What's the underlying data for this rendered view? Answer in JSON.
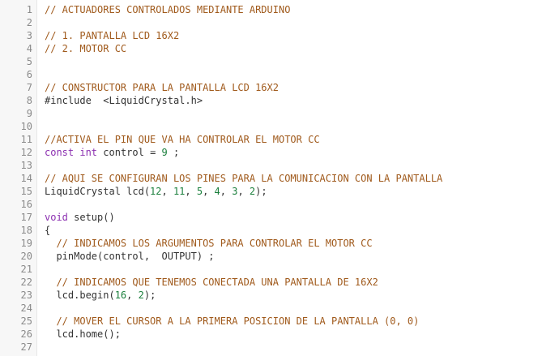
{
  "colors": {
    "comment": "#a05a1c",
    "keyword": "#8b2fb0",
    "number": "#1a7f3c",
    "plain": "#333333",
    "line_number": "#8a8a8a",
    "gutter_background": "#f7f7f7"
  },
  "lines": [
    {
      "number": "1",
      "tokens": [
        {
          "type": "comment",
          "text": "// ACTUADORES CONTROLADOS MEDIANTE ARDUINO"
        }
      ]
    },
    {
      "number": "2",
      "tokens": []
    },
    {
      "number": "3",
      "tokens": [
        {
          "type": "comment",
          "text": "// 1. PANTALLA LCD 16X2"
        }
      ]
    },
    {
      "number": "4",
      "tokens": [
        {
          "type": "comment",
          "text": "// 2. MOTOR CC"
        }
      ]
    },
    {
      "number": "5",
      "tokens": []
    },
    {
      "number": "6",
      "tokens": []
    },
    {
      "number": "7",
      "tokens": [
        {
          "type": "comment",
          "text": "// CONSTRUCTOR PARA LA PANTALLA LCD 16X2"
        }
      ]
    },
    {
      "number": "8",
      "tokens": [
        {
          "type": "plain",
          "text": "#include  <LiquidCrystal.h>"
        }
      ]
    },
    {
      "number": "9",
      "tokens": []
    },
    {
      "number": "10",
      "tokens": []
    },
    {
      "number": "11",
      "tokens": [
        {
          "type": "comment",
          "text": "//ACTIVA EL PIN QUE VA HA CONTROLAR EL MOTOR CC"
        }
      ]
    },
    {
      "number": "12",
      "tokens": [
        {
          "type": "keyword",
          "text": "const"
        },
        {
          "type": "plain",
          "text": " "
        },
        {
          "type": "keyword",
          "text": "int"
        },
        {
          "type": "plain",
          "text": " control = "
        },
        {
          "type": "number",
          "text": "9"
        },
        {
          "type": "plain",
          "text": " ;"
        }
      ]
    },
    {
      "number": "13",
      "tokens": []
    },
    {
      "number": "14",
      "tokens": [
        {
          "type": "comment",
          "text": "// AQUI SE CONFIGURAN LOS PINES PARA LA COMUNICACION CON LA PANTALLA"
        }
      ]
    },
    {
      "number": "15",
      "tokens": [
        {
          "type": "plain",
          "text": "LiquidCrystal lcd("
        },
        {
          "type": "number",
          "text": "12"
        },
        {
          "type": "plain",
          "text": ", "
        },
        {
          "type": "number",
          "text": "11"
        },
        {
          "type": "plain",
          "text": ", "
        },
        {
          "type": "number",
          "text": "5"
        },
        {
          "type": "plain",
          "text": ", "
        },
        {
          "type": "number",
          "text": "4"
        },
        {
          "type": "plain",
          "text": ", "
        },
        {
          "type": "number",
          "text": "3"
        },
        {
          "type": "plain",
          "text": ", "
        },
        {
          "type": "number",
          "text": "2"
        },
        {
          "type": "plain",
          "text": ");"
        }
      ]
    },
    {
      "number": "16",
      "tokens": []
    },
    {
      "number": "17",
      "tokens": [
        {
          "type": "keyword",
          "text": "void"
        },
        {
          "type": "plain",
          "text": " setup()"
        }
      ]
    },
    {
      "number": "18",
      "tokens": [
        {
          "type": "plain",
          "text": "{"
        }
      ]
    },
    {
      "number": "19",
      "tokens": [
        {
          "type": "comment",
          "text": "  // INDICAMOS LOS ARGUMENTOS PARA CONTROLAR EL MOTOR CC"
        }
      ]
    },
    {
      "number": "20",
      "tokens": [
        {
          "type": "plain",
          "text": "  pinMode(control,  OUTPUT) ;"
        }
      ]
    },
    {
      "number": "21",
      "tokens": []
    },
    {
      "number": "22",
      "tokens": [
        {
          "type": "comment",
          "text": "  // INDICAMOS QUE TENEMOS CONECTADA UNA PANTALLA DE 16X2"
        }
      ]
    },
    {
      "number": "23",
      "tokens": [
        {
          "type": "plain",
          "text": "  lcd.begin("
        },
        {
          "type": "number",
          "text": "16"
        },
        {
          "type": "plain",
          "text": ", "
        },
        {
          "type": "number",
          "text": "2"
        },
        {
          "type": "plain",
          "text": ");"
        }
      ]
    },
    {
      "number": "24",
      "tokens": []
    },
    {
      "number": "25",
      "tokens": [
        {
          "type": "comment",
          "text": "  // MOVER EL CURSOR A LA PRIMERA POSICION DE LA PANTALLA (0, 0)"
        }
      ]
    },
    {
      "number": "26",
      "tokens": [
        {
          "type": "plain",
          "text": "  lcd.home();"
        }
      ]
    },
    {
      "number": "27",
      "tokens": []
    }
  ]
}
